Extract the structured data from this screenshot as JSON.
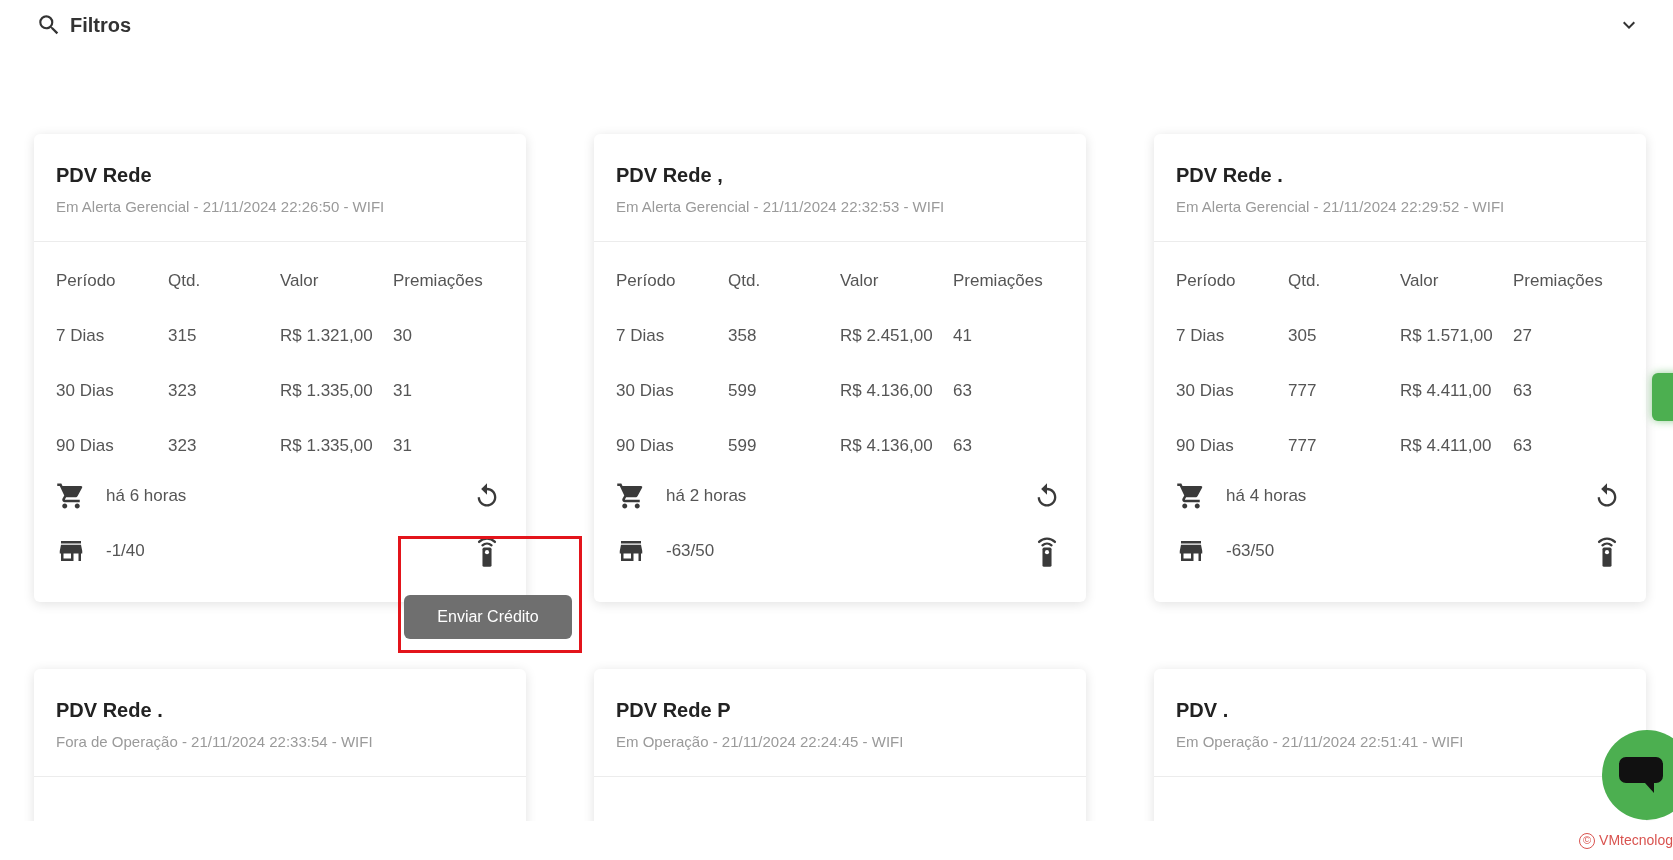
{
  "filters": {
    "title": "Filtros",
    "expanded": false
  },
  "cards": [
    {
      "title": "PDV Rede",
      "subtitle": "Em Alerta Gerencial - 21/11/2024 22:26:50 - WIFI",
      "columns": [
        "Período",
        "Qtd.",
        "Valor",
        "Premiações"
      ],
      "rows": [
        [
          "7 Dias",
          "315",
          "R$ 1.321,00",
          "30"
        ],
        [
          "30 Dias",
          "323",
          "R$ 1.335,00",
          "31"
        ],
        [
          "90 Dias",
          "323",
          "R$ 1.335,00",
          "31"
        ]
      ],
      "last_sale": "há 6 horas",
      "machines": "-1/40",
      "tooltip": {
        "text": "Enviar Crédito",
        "annotated": true
      }
    },
    {
      "title": "PDV Rede ,",
      "subtitle": "Em Alerta Gerencial - 21/11/2024 22:32:53 - WIFI",
      "columns": [
        "Período",
        "Qtd.",
        "Valor",
        "Premiações"
      ],
      "rows": [
        [
          "7 Dias",
          "358",
          "R$ 2.451,00",
          "41"
        ],
        [
          "30 Dias",
          "599",
          "R$ 4.136,00",
          "63"
        ],
        [
          "90 Dias",
          "599",
          "R$ 4.136,00",
          "63"
        ]
      ],
      "last_sale": "há 2 horas",
      "machines": "-63/50"
    },
    {
      "title": "PDV Rede .",
      "subtitle": "Em Alerta Gerencial - 21/11/2024 22:29:52 - WIFI",
      "columns": [
        "Período",
        "Qtd.",
        "Valor",
        "Premiações"
      ],
      "rows": [
        [
          "7 Dias",
          "305",
          "R$ 1.571,00",
          "27"
        ],
        [
          "30 Dias",
          "777",
          "R$ 4.411,00",
          "63"
        ],
        [
          "90 Dias",
          "777",
          "R$ 4.411,00",
          "63"
        ]
      ],
      "last_sale": "há 4 horas",
      "machines": "-63/50"
    },
    {
      "title": "PDV Rede .",
      "subtitle": "Fora de Operação - 21/11/2024 22:33:54 - WIFI"
    },
    {
      "title": "PDV Rede P",
      "subtitle": "Em Operação - 21/11/2024 22:24:45 - WIFI"
    },
    {
      "title": "PDV .",
      "subtitle": "Em Operação - 21/11/2024 22:51:41 - WIFI"
    }
  ],
  "footer": {
    "symbol": "©",
    "text": "VMtecnolog"
  }
}
